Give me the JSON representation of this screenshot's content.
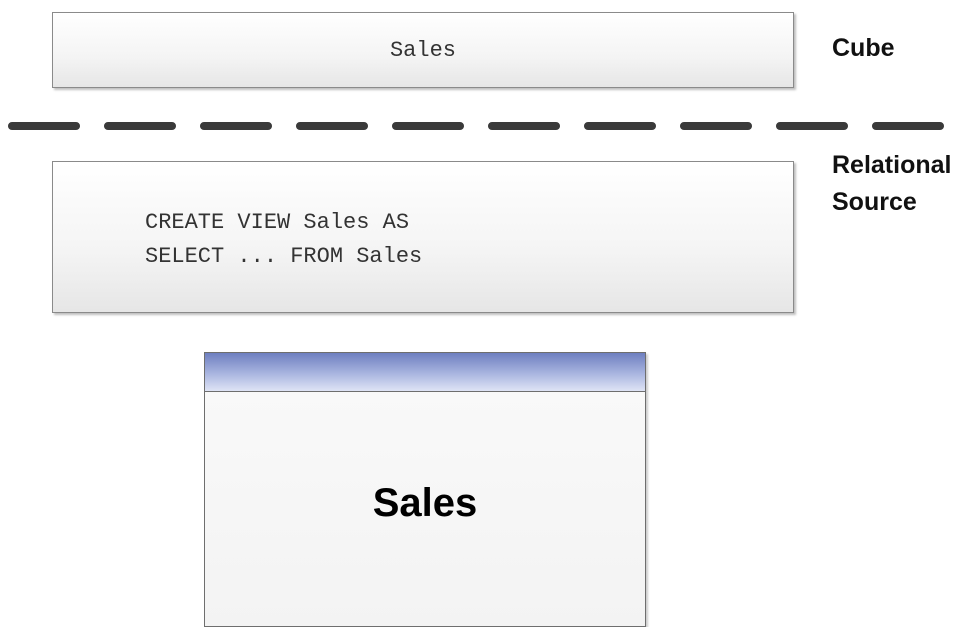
{
  "cube_box": {
    "text": "Sales"
  },
  "view_box": {
    "line1": "CREATE VIEW Sales AS",
    "line2": "SELECT ... FROM Sales"
  },
  "labels": {
    "cube": "Cube",
    "relational": "Relational",
    "source": "Source"
  },
  "table_entity": {
    "name": "Sales",
    "header_color": "#8a98cf"
  },
  "divider": {
    "color": "#3a3a3a",
    "style": "dashed"
  }
}
